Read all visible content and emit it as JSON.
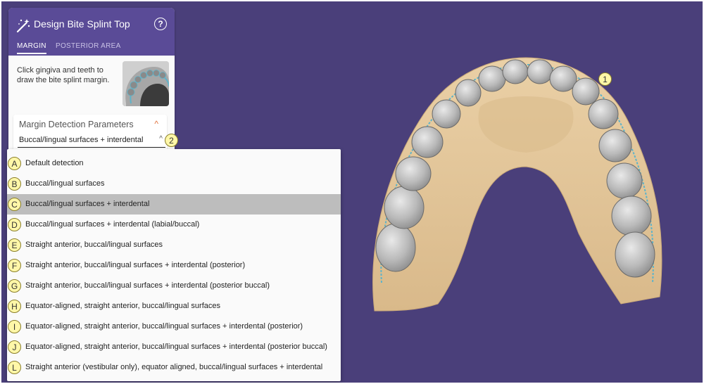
{
  "panel": {
    "title": "Design Bite Splint Top",
    "help_icon": "?",
    "tabs": [
      "MARGIN",
      "POSTERIOR AREA"
    ],
    "active_tab": "MARGIN",
    "instructions": "Click gingiva and teeth to draw the bite splint margin."
  },
  "params": {
    "title": "Margin Detection Parameters",
    "expanded_icon": "^",
    "selected": "Buccal/lingual surfaces + interdental",
    "select_chevron": "^"
  },
  "options": [
    {
      "marker": "A",
      "label": "Default detection"
    },
    {
      "marker": "B",
      "label": "Buccal/lingual surfaces"
    },
    {
      "marker": "C",
      "label": "Buccal/lingual surfaces + interdental"
    },
    {
      "marker": "D",
      "label": "Buccal/lingual surfaces + interdental (labial/buccal)"
    },
    {
      "marker": "E",
      "label": "Straight anterior, buccal/lingual surfaces"
    },
    {
      "marker": "F",
      "label": "Straight anterior, buccal/lingual surfaces + interdental (posterior)"
    },
    {
      "marker": "G",
      "label": "Straight anterior, buccal/lingual surfaces + interdental (posterior buccal)"
    },
    {
      "marker": "H",
      "label": "Equator-aligned, straight anterior, buccal/lingual surfaces"
    },
    {
      "marker": "I",
      "label": "Equator-aligned, straight anterior, buccal/lingual surfaces + interdental (posterior)"
    },
    {
      "marker": "J",
      "label": "Equator-aligned, straight anterior, buccal/lingual surfaces + interdental (posterior buccal)"
    },
    {
      "marker": "L",
      "label": "Straight anterior (vestibular only), equator aligned, buccal/lingual surfaces + interdental"
    }
  ],
  "selected_index": 2,
  "callouts": {
    "model": "1",
    "select": "2"
  },
  "colors": {
    "header": "#5a4b97",
    "background": "#4a3f7a",
    "accent": "#e0703a",
    "selection": "#bdbdbd",
    "callout": "#fff7a8"
  }
}
